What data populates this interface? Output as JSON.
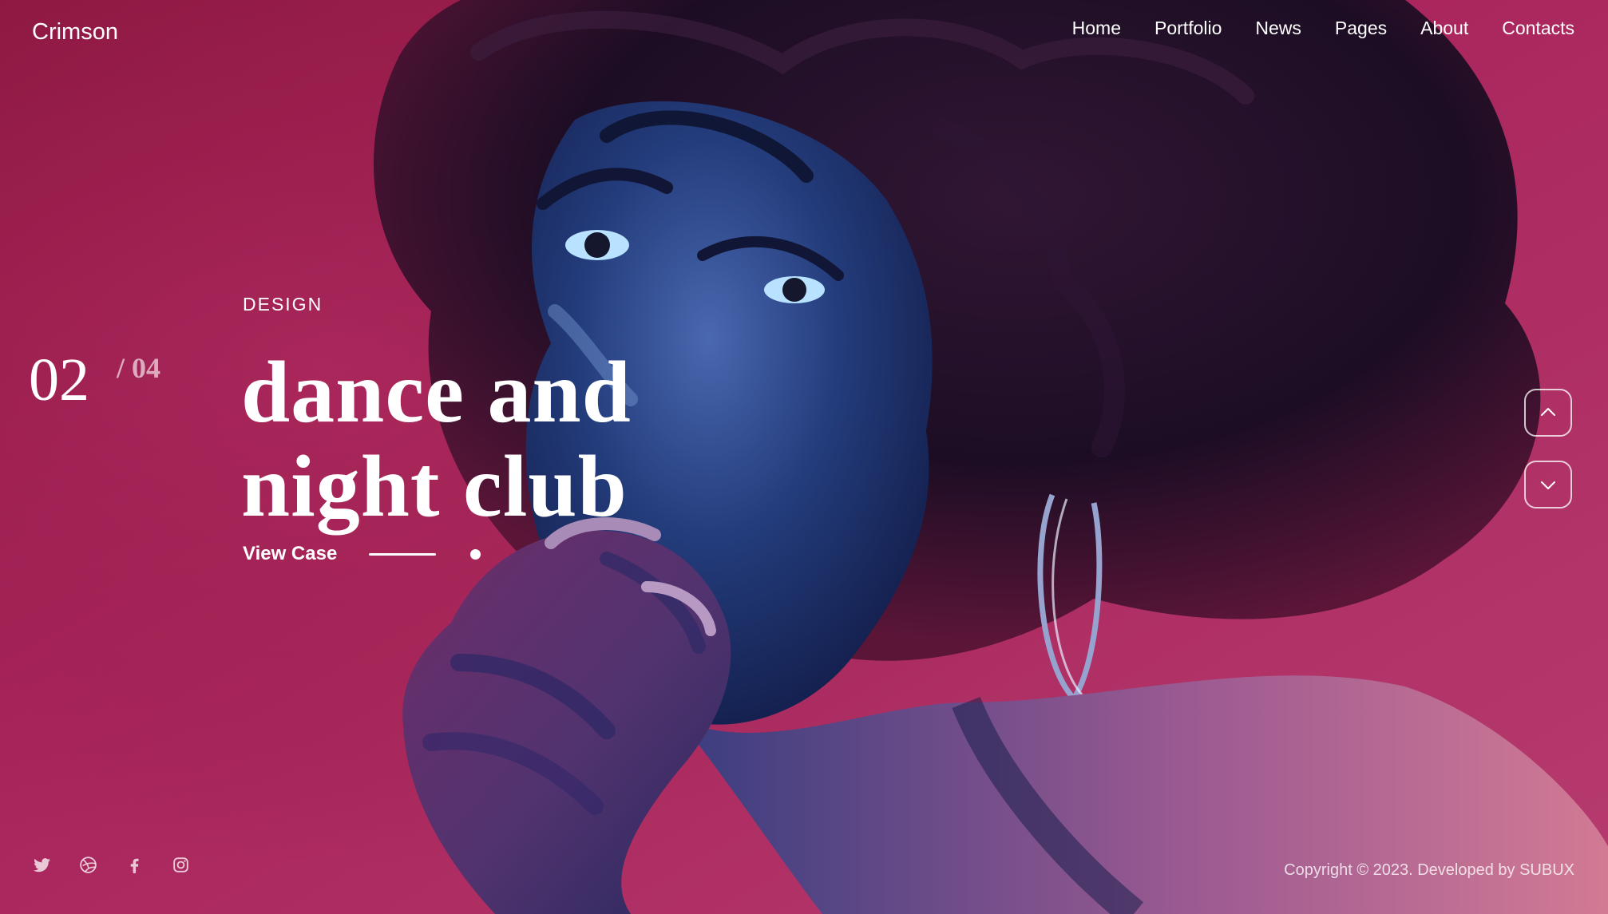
{
  "brand": {
    "logo": "Crimson"
  },
  "nav": {
    "items": [
      "Home",
      "Portfolio",
      "News",
      "Pages",
      "About",
      "Contacts"
    ]
  },
  "slide": {
    "current": "02",
    "total": "/ 04",
    "category": "DESIGN",
    "title_line1": "dance and",
    "title_line2": "night club",
    "cta": "View Case"
  },
  "controls": {
    "up_icon": "chevron-up-icon",
    "down_icon": "chevron-down-icon"
  },
  "social": {
    "icons": [
      "twitter-icon",
      "dribbble-icon",
      "facebook-icon",
      "instagram-icon"
    ]
  },
  "footer": {
    "copyright": "Copyright © 2023. Developed by SUBUX"
  },
  "colors": {
    "background": "#9b1f4c",
    "accent": "#ffffff",
    "photo_shadow": "#1c1f5e"
  }
}
